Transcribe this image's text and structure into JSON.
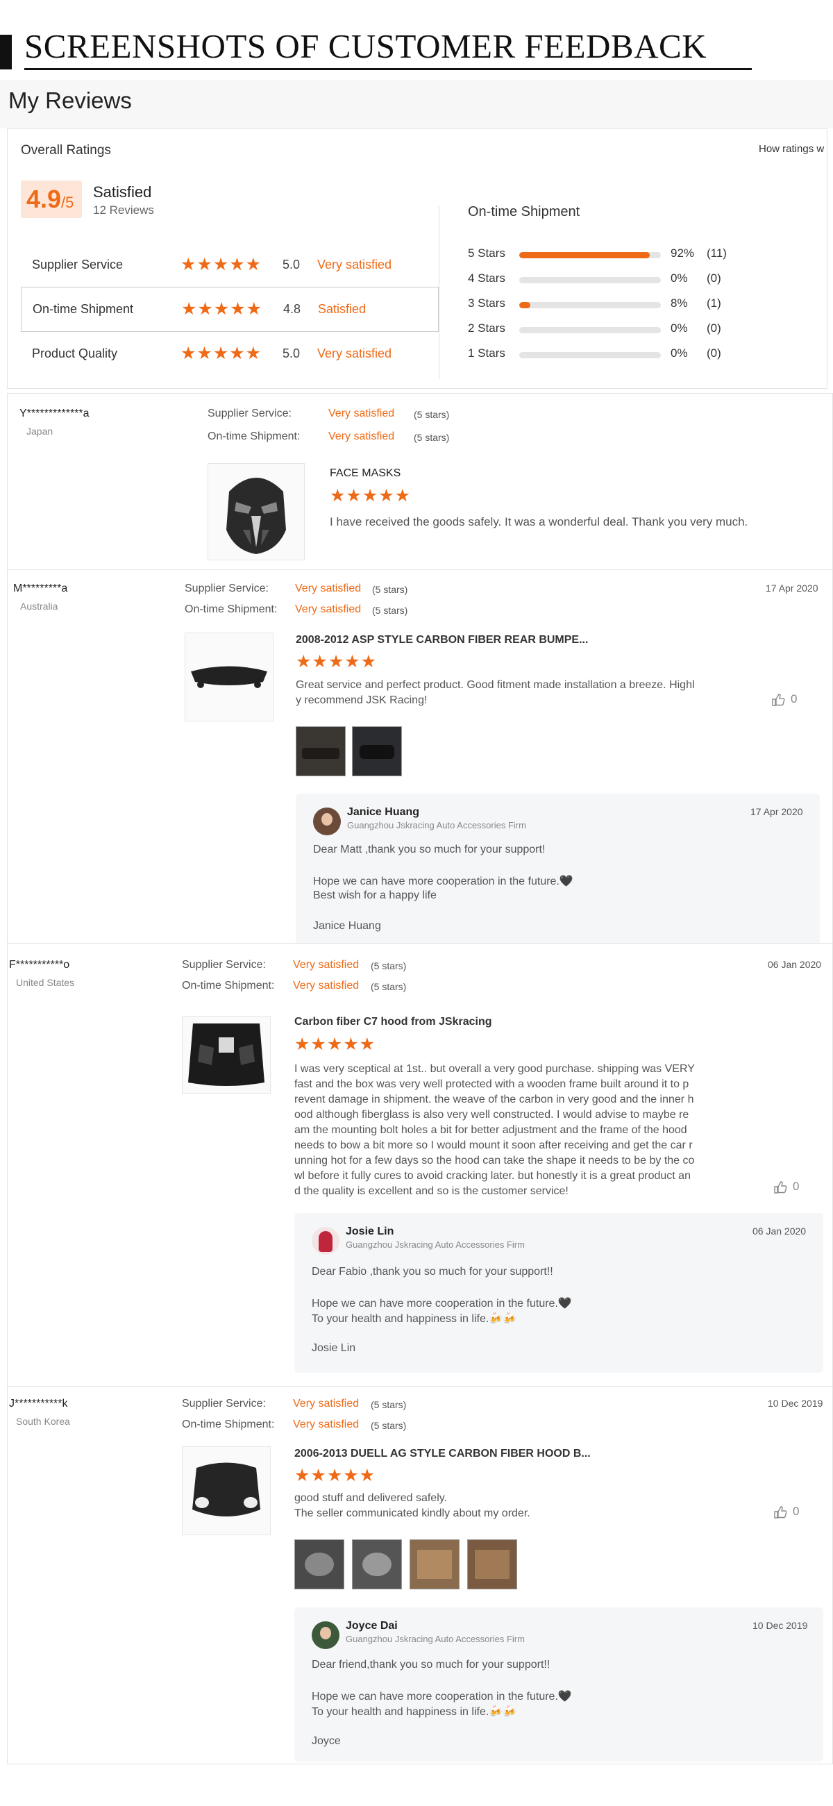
{
  "banner": {
    "title": "SCREENSHOTS OF CUSTOMER FEEDBACK"
  },
  "page": {
    "title": "My Reviews"
  },
  "summary": {
    "overall_label": "Overall Ratings",
    "how_rated": "How ratings w",
    "score": "4.9",
    "score_suffix": "/5",
    "score_word": "Satisfied",
    "review_count": "12 Reviews",
    "categories": [
      {
        "name": "Supplier Service",
        "value": "5.0",
        "word": "Very satisfied",
        "stars": "★★★★★"
      },
      {
        "name": "On-time Shipment",
        "value": "4.8",
        "word": "Satisfied",
        "stars": "★★★★★"
      },
      {
        "name": "Product Quality",
        "value": "5.0",
        "word": "Very satisfied",
        "stars": "★★★★★"
      }
    ],
    "breakdown_title": "On-time Shipment",
    "breakdown": [
      {
        "label": "5 Stars",
        "percent": 92,
        "pct_text": "92%",
        "count": "(11)"
      },
      {
        "label": "4 Stars",
        "percent": 0,
        "pct_text": "0%",
        "count": "(0)"
      },
      {
        "label": "3 Stars",
        "percent": 8,
        "pct_text": "8%",
        "count": "(1)"
      },
      {
        "label": "2 Stars",
        "percent": 0,
        "pct_text": "0%",
        "count": "(0)"
      },
      {
        "label": "1 Stars",
        "percent": 0,
        "pct_text": "0%",
        "count": "(0)"
      }
    ]
  },
  "labels": {
    "supplier_service": "Supplier Service:",
    "on_time": "On-time Shipment:",
    "five_stars": "(5 stars)",
    "stars": "★★★★★"
  },
  "reviews": [
    {
      "user": "Y*************a",
      "country": "Japan",
      "supplier": "Very satisfied",
      "shipment": "Very satisfied",
      "product": "FACE MASKS",
      "text": "I have received the goods safely. It was a wonderful deal. Thank you very much."
    },
    {
      "user": "M*********a",
      "country": "Australia",
      "supplier": "Very satisfied",
      "shipment": "Very satisfied",
      "date": "17 Apr 2020",
      "product": "2008-2012 ASP STYLE CARBON FIBER REAR BUMPE...",
      "text": "Great service and perfect product. Good fitment made installation a breeze. Highl\ny recommend JSK Racing!",
      "likes": "0",
      "reply": {
        "name": "Janice Huang",
        "firm": "Guangzhou Jskracing Auto Accessories Firm",
        "date": "17 Apr 2020",
        "lines": [
          "Dear Matt ,thank you so much for your support!",
          "Hope we can have more cooperation in the future.🖤",
          "Best wish for a happy life",
          "Janice Huang"
        ]
      }
    },
    {
      "user": "F***********o",
      "country": "United States",
      "supplier": "Very satisfied",
      "shipment": "Very satisfied",
      "date": "06 Jan 2020",
      "product": "Carbon fiber C7 hood from JSkracing",
      "text": "I was very sceptical at 1st.. but overall a very good purchase.  shipping was VERY\nfast and the box was very well protected with a wooden frame built around it  to p\nrevent damage in shipment.  the weave of the carbon in very good and the inner h\nood although fiberglass is also very well constructed.  I would advise to maybe re\nam the mounting bolt holes a bit for better adjustment and the  frame of the hood\nneeds to bow a bit more so I would mount it soon after receiving and get the car r\nunning hot for a few days so the hood can take the shape it needs to be by the co\nwl before it fully cures to avoid cracking later. but honestly it is a great product an\nd the quality is excellent and so is the customer service!",
      "likes": "0",
      "reply": {
        "name": "Josie Lin",
        "firm": "Guangzhou Jskracing Auto Accessories Firm",
        "date": "06 Jan 2020",
        "lines": [
          "Dear Fabio ,thank you so much for your support!!",
          "Hope we can have more cooperation in the future.🖤",
          "To your health and happiness in life.🍻🍻",
          "Josie Lin"
        ]
      }
    },
    {
      "user": "J***********k",
      "country": "South Korea",
      "supplier": "Very satisfied",
      "shipment": "Very satisfied",
      "date": "10 Dec 2019",
      "product": "2006-2013 DUELL AG STYLE CARBON FIBER HOOD B...",
      "text": "good stuff and delivered safely.\nThe seller communicated kindly about my order.",
      "likes": "0",
      "reply": {
        "name": "Joyce Dai",
        "firm": "Guangzhou Jskracing Auto Accessories Firm",
        "date": "10 Dec 2019",
        "lines": [
          "Dear friend,thank you so much for your support!!",
          "Hope we can have more cooperation in the future.🖤",
          "To your health and happiness in life.🍻🍻",
          "Joyce"
        ]
      }
    }
  ],
  "colors": {
    "accent": "#ef6a17",
    "score_bg": "#fde6d8",
    "reply_bg": "#f5f6f8"
  }
}
